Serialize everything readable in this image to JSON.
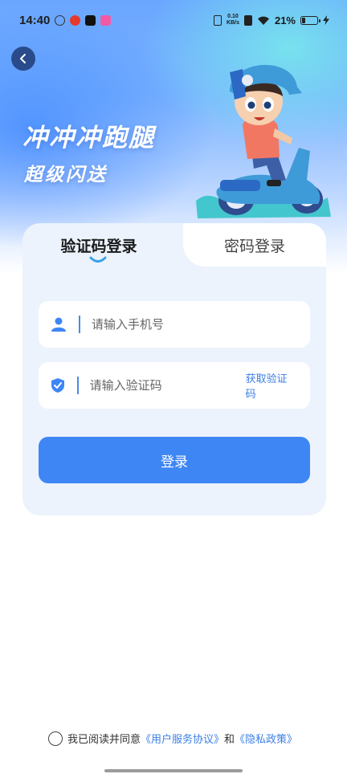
{
  "status_bar": {
    "time": "14:40",
    "net_speed_value": "0.10",
    "net_speed_unit": "KB/s",
    "battery_percent": "21%",
    "battery_level": 0.21
  },
  "header": {
    "brand_title": "冲冲冲跑腿",
    "brand_subtitle": "超级闪送"
  },
  "tabs": {
    "active": "验证码登录",
    "inactive": "密码登录"
  },
  "form": {
    "phone_placeholder": "请输入手机号",
    "code_placeholder": "请输入验证码",
    "get_code_label": "获取验证码",
    "login_label": "登录"
  },
  "agreement": {
    "prefix": "我已阅读并同意",
    "user_agreement": "《用户服务协议》",
    "and": "和",
    "privacy_policy": "《隐私政策》"
  },
  "colors": {
    "accent": "#3f86f5",
    "link": "#3b7fe6",
    "card_bg": "#ecf3fd"
  },
  "icons": {
    "back": "chevron-left-icon",
    "phone": "user-icon",
    "code": "shield-check-icon"
  }
}
